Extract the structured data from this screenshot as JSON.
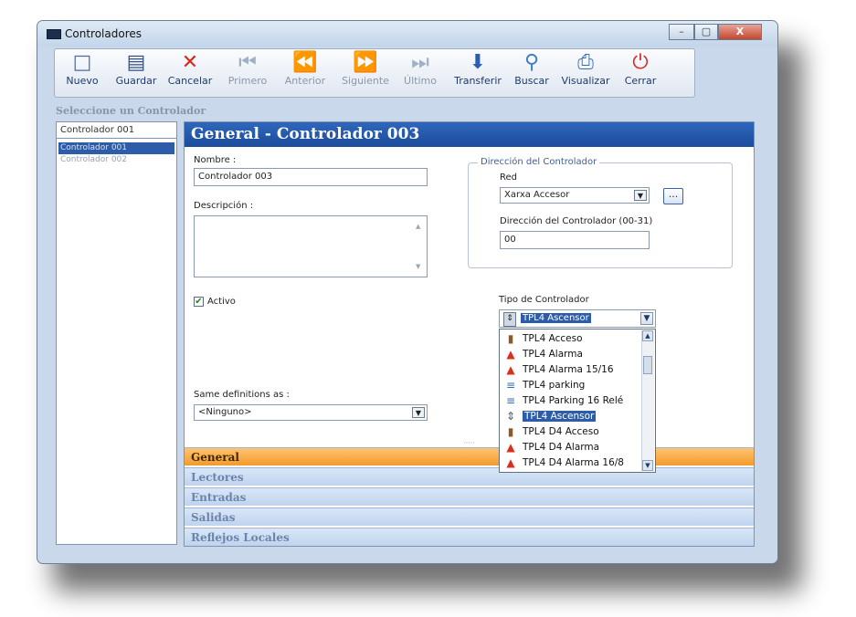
{
  "window": {
    "title": "Controladores",
    "btn_min": "–",
    "btn_max": "▢",
    "btn_close": "X"
  },
  "toolbar": [
    {
      "label": "Nuevo",
      "icon": "new-icon",
      "glyph": "□",
      "color": "#4a6d9c",
      "enabled": true
    },
    {
      "label": "Guardar",
      "icon": "save-icon",
      "glyph": "▤",
      "color": "#2f4f86",
      "enabled": true
    },
    {
      "label": "Cancelar",
      "icon": "cancel-icon",
      "glyph": "✕",
      "color": "#d72a1c",
      "enabled": true
    },
    {
      "label": "Primero",
      "icon": "first-icon",
      "glyph": "⏮",
      "color": "#9fb1c6",
      "enabled": false
    },
    {
      "label": "Anterior",
      "icon": "previous-icon",
      "glyph": "⏪",
      "color": "#9fb1c6",
      "enabled": false
    },
    {
      "label": "Siguiente",
      "icon": "next-icon",
      "glyph": "⏩",
      "color": "#9fb1c6",
      "enabled": false
    },
    {
      "label": "Último",
      "icon": "last-icon",
      "glyph": "⏭",
      "color": "#9fb1c6",
      "enabled": false
    },
    {
      "label": "Transferir",
      "icon": "transfer-icon",
      "glyph": "⬇",
      "color": "#2c5db0",
      "enabled": true
    },
    {
      "label": "Buscar",
      "icon": "search-icon",
      "glyph": "⚲",
      "color": "#3f7fc4",
      "enabled": true
    },
    {
      "label": "Visualizar",
      "icon": "print-icon",
      "glyph": "⎙",
      "color": "#3a6bb0",
      "enabled": true
    },
    {
      "label": "Cerrar",
      "icon": "power-icon",
      "glyph": "⏻",
      "color": "#d92b2b",
      "enabled": true
    }
  ],
  "sidebar": {
    "title": "Seleccione un Controlador",
    "search_value": "Controlador 001",
    "items": [
      "Controlador 001",
      "Controlador 002"
    ],
    "selected_index": 0
  },
  "panel": {
    "header": "General - Controlador 003",
    "nombre_label": "Nombre :",
    "nombre_value": "Controlador 003",
    "descripcion_label": "Descripción :",
    "descripcion_value": "",
    "activo_label": "Activo",
    "activo_checked": true,
    "same_label": "Same definitions as :",
    "same_value": "<Ninguno>"
  },
  "direccion": {
    "legend": "Dirección del Controlador",
    "red_label": "Red",
    "red_value": "Xarxa Accesor",
    "more_button": "...",
    "dir_label": "Dirección del Controlador (00-31)",
    "dir_value": "00"
  },
  "tipo": {
    "label": "Tipo de Controlador",
    "selected": "TPL4 Ascensor",
    "options": [
      {
        "label": "TPL4 Acceso",
        "icon": "door-icon"
      },
      {
        "label": "TPL4 Alarma",
        "icon": "alarm-icon"
      },
      {
        "label": "TPL4 Alarma 15/16",
        "icon": "alarm-icon"
      },
      {
        "label": "TPL4 parking",
        "icon": "parking-icon"
      },
      {
        "label": "TPL4 Parking 16 Relé",
        "icon": "parking-icon"
      },
      {
        "label": "TPL4 Ascensor",
        "icon": "elevator-icon"
      },
      {
        "label": "TPL4 D4 Acceso",
        "icon": "door-icon"
      },
      {
        "label": "TPL4 D4 Alarma",
        "icon": "alarm-icon"
      },
      {
        "label": "TPL4 D4 Alarma 16/8",
        "icon": "alarm-icon"
      }
    ],
    "selected_option_index": 5
  },
  "sections": [
    "General",
    "Lectores",
    "Entradas",
    "Salidas",
    "Reflejos Locales"
  ],
  "active_section_index": 0,
  "splitter_glyph": "·····"
}
